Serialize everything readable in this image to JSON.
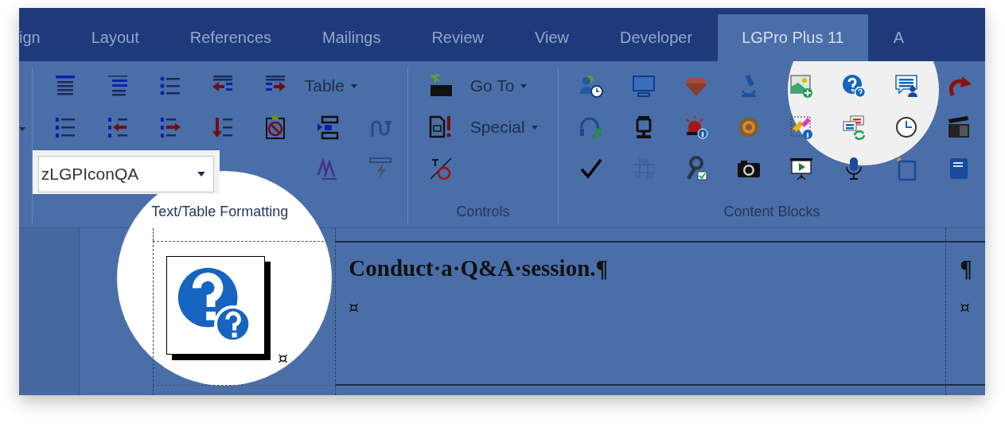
{
  "tabs": [
    {
      "label": "ign",
      "selected": false
    },
    {
      "label": "Layout",
      "selected": false
    },
    {
      "label": "References",
      "selected": false
    },
    {
      "label": "Mailings",
      "selected": false
    },
    {
      "label": "Review",
      "selected": false
    },
    {
      "label": "View",
      "selected": false
    },
    {
      "label": "Developer",
      "selected": false
    },
    {
      "label": "LGPro Plus 11",
      "selected": true
    },
    {
      "label": "A",
      "selected": false
    }
  ],
  "ribbon": {
    "groups": [
      {
        "label": "Text/Table Formatting",
        "dropdowns": [
          {
            "label": "Table"
          }
        ],
        "style_box": {
          "value": "zLGPIconQA"
        }
      },
      {
        "label": "Controls",
        "dropdowns": [
          {
            "label": "Go To"
          },
          {
            "label": "Special"
          }
        ]
      },
      {
        "label": "Content Blocks"
      }
    ]
  },
  "document": {
    "cells": [
      {
        "mark": "¤"
      },
      {
        "heading": "Conduct·a·Q&A·session.¶",
        "mark": "¤"
      },
      {
        "heading": "¶",
        "mark": "¤"
      }
    ]
  }
}
